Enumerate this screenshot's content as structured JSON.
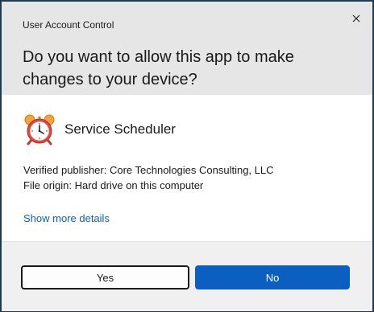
{
  "dialog": {
    "window_title": "User Account Control",
    "question": "Do you want to allow this app to make changes to your device?",
    "close_glyph": "✕",
    "close_icon": "close-icon"
  },
  "app": {
    "name": "Service Scheduler",
    "icon": "alarm-clock-icon",
    "publisher_line": "Verified publisher: Core Technologies Consulting, LLC",
    "origin_line": "File origin: Hard drive on this computer"
  },
  "details_link": "Show more details",
  "buttons": {
    "yes_label": "Yes",
    "no_label": "No"
  },
  "colors": {
    "accent": "#0a5fc0",
    "link": "#0a63b0",
    "header_bg": "#e6e6e6",
    "footer_bg": "#f0f0f0",
    "border": "#1f3b53"
  }
}
